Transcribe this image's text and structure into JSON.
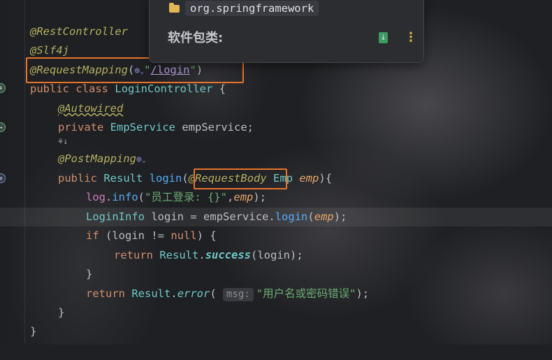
{
  "popup": {
    "package_name": "org.springframework",
    "category_label": "软件包类:",
    "folder_icon": "folder-icon",
    "action_icon": "download-sources-icon",
    "more_icon": "more-vertical-icon"
  },
  "editor": {
    "lines": {
      "rest_controller": "@RestController",
      "slf4j": "@Slf4j",
      "request_mapping": {
        "annotation": "@RequestMapping",
        "open": "(",
        "quote_open": "\"",
        "path": "/login",
        "quote_close": "\"",
        "close": ")"
      },
      "class_decl": {
        "kw1": "public",
        "kw2": "class",
        "name": "LoginController",
        "brace": "{"
      },
      "autowired": "@Autowired",
      "field_decl": {
        "kw": "private",
        "type": "EmpService",
        "name": "empService;"
      },
      "post_mapping": "@PostMapping",
      "method_decl": {
        "kw": "public",
        "type": "Result",
        "name": "login",
        "open": "(",
        "annotation": "@RequestBody",
        "ptype": "Emp",
        "pname": "emp",
        "close": "){"
      },
      "log_line": {
        "obj": "log",
        "dot": ".",
        "method": "info",
        "open": "(",
        "str": "\"员工登录: {}\"",
        "comma": ",",
        "arg": "emp",
        "close": ");"
      },
      "login_info": {
        "type": "LoginInfo",
        "var": "login",
        "eq": "=",
        "obj": "empService",
        "dot": ".",
        "method": "login",
        "open": "(",
        "arg": "emp",
        "close": ");"
      },
      "if_line": {
        "kw": "if",
        "cond_open": "(login != ",
        "null": "null",
        "cond_close": ") {"
      },
      "return_success": {
        "kw": "return",
        "cls": "Result",
        "dot": ".",
        "method": "success",
        "args": "(login);"
      },
      "close_if": "}",
      "return_error": {
        "kw": "return",
        "cls": "Result",
        "dot": ".",
        "method": "error",
        "open": "(",
        "hint": "msg:",
        "str": "\"用户名或密码错误\"",
        "close": ");"
      },
      "close_method": "}",
      "close_class": "}"
    }
  },
  "colors": {
    "annotation": "#b3ae60",
    "keyword": "#cf8e6d",
    "class": "#6ec8c5",
    "string": "#6aab73",
    "highlight_box": "#e8732a"
  }
}
